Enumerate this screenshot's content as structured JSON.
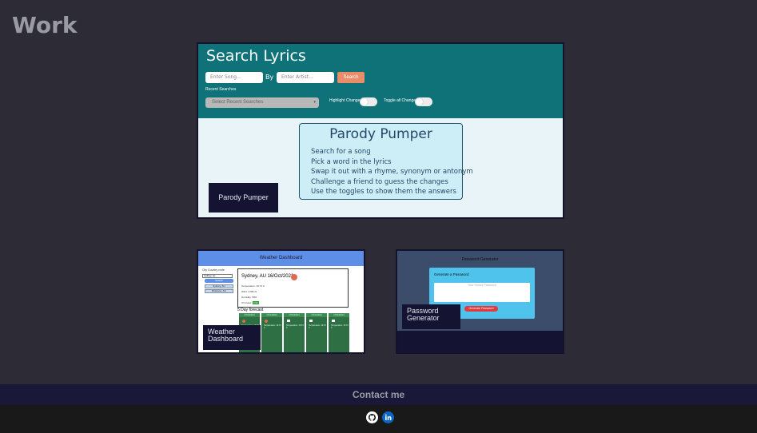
{
  "section_title": "Work",
  "featured": {
    "app_title": "Search Lyrics",
    "song_placeholder": "Enter Song...",
    "by_label": "By",
    "artist_placeholder": "Enter Artist...",
    "search_button": "Search",
    "recent_label": "Recent Searches",
    "recent_select": "Select Recent Searches",
    "highlight_label": "Highlight Changes",
    "toggle_all_label": "Toggle all Changes",
    "info_title": "Parody Pumper",
    "info_steps": [
      "Search for a song",
      "Pick a word in the lyrics",
      "Swap it out with a rhyme, synonym or antonym",
      "Challenge a friend to guess the changes",
      "Use the toggles to show them the answers"
    ],
    "project_label": "Parody Pumper"
  },
  "weather": {
    "header": "Weather Dashboard",
    "city_label": "City Country code",
    "input_value": "sydney, au",
    "search_button": "Search",
    "history": [
      "Sydney, AU",
      "Brisbane, AU"
    ],
    "current_title": "Sydney, AU 16/Oct/2021",
    "details": [
      "Temperature: 19.73 C",
      "Wind: 4.68m/s",
      "Humidity: 59%",
      "UV index:"
    ],
    "uv_value": "3.93",
    "forecast_label": "5 Day forecast",
    "day_band": "17/Oct/2021",
    "project_label_line1": "Weather",
    "project_label_line2": "Dashboard"
  },
  "password": {
    "header": "Password Generator",
    "box_title": "Generate a Password",
    "placeholder": "Your Secure Password",
    "button": "Generate Password",
    "project_label_line1": "Password",
    "project_label_line2": "Generator"
  },
  "footer": {
    "contact": "Contact me",
    "github_icon": "github-icon",
    "linkedin_icon": "linkedin-icon"
  },
  "colors": {
    "page_bg": "#2d2b35",
    "teal_header": "#0e7278",
    "label_bg": "#141331",
    "contact_bar": "#191838",
    "social_bar": "#191919",
    "linkedin_blue": "#0a66c2"
  }
}
